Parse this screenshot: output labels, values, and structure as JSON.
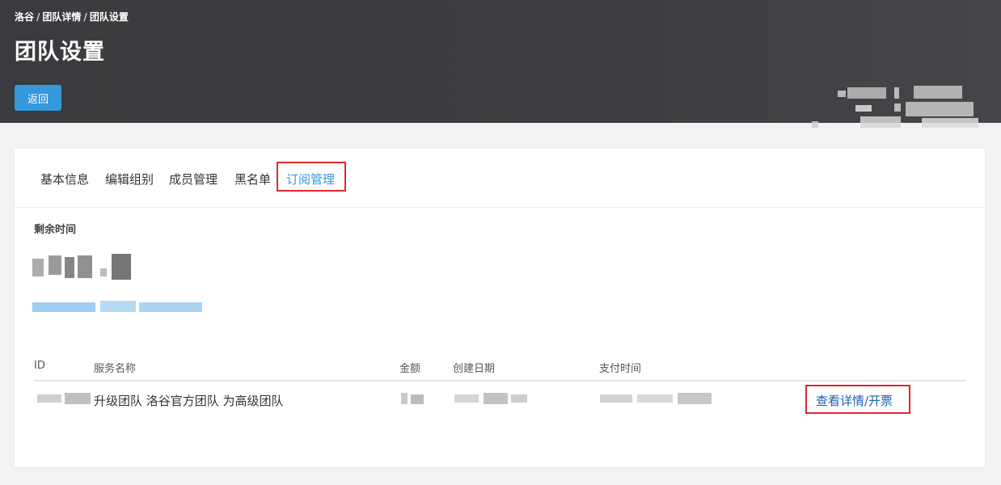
{
  "breadcrumb": {
    "items": [
      "洛谷",
      "团队详情",
      "团队设置"
    ],
    "separator": "/"
  },
  "page": {
    "title": "团队设置",
    "back_label": "返回"
  },
  "tabs": [
    {
      "label": "基本信息",
      "active": false
    },
    {
      "label": "编辑组别",
      "active": false
    },
    {
      "label": "成员管理",
      "active": false
    },
    {
      "label": "黑名单",
      "active": false
    },
    {
      "label": "订阅管理",
      "active": true
    }
  ],
  "subscription": {
    "remaining_label": "剩余时间"
  },
  "table": {
    "headers": [
      "ID",
      "服务名称",
      "金额",
      "创建日期",
      "支付时间",
      ""
    ],
    "rows": [
      {
        "service_name": "升级团队 洛谷官方团队 为高级团队",
        "action_label": "查看详情/开票"
      }
    ]
  },
  "colors": {
    "header_bg": "#3d3e41",
    "accent": "#3498db",
    "link": "#1a5fb4",
    "highlight": "#e3262b"
  }
}
